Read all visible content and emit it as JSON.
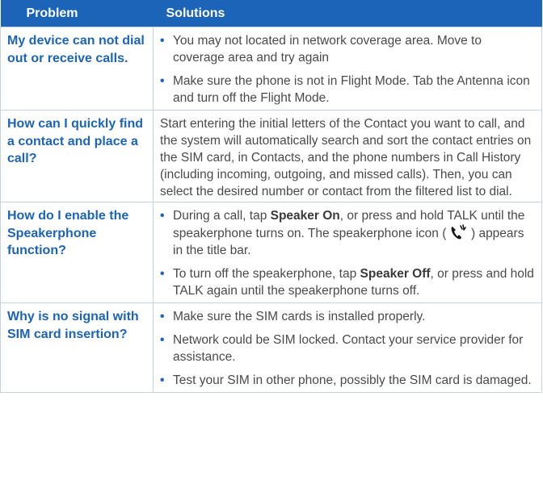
{
  "header": {
    "problem": "Problem",
    "solutions": "Solutions"
  },
  "rows": [
    {
      "problem": "My device can not dial out or receive calls.",
      "bullets": [
        "You may not located in network coverage area. Move to coverage area and try again",
        "Make sure the phone is not in Flight Mode. Tab the Antenna icon and turn off the Flight Mode."
      ]
    },
    {
      "problem": "How can I quickly find a contact and place a call?",
      "paragraph": "Start entering the initial letters of the Contact you want to call, and the system will automatically search and sort the contact entries on the SIM card, in Contacts, and the phone numbers in Call History (including incoming, outgoing, and missed calls). Then, you can select the desired number or contact from the filtered list to dial."
    },
    {
      "problem": "How do I enable the Speakerphone function?",
      "b1": {
        "pre": "During a call, tap ",
        "bold": "Speaker On",
        "post": ", or press and hold TALK until the speakerphone turns on. The speakerphone icon ( ",
        "icon": "speakerphone-icon",
        "post2": " ) appears in the title bar."
      },
      "b2": {
        "pre": "To turn off the speakerphone, tap ",
        "bold": "Speaker Off",
        "post": ", or press and hold TALK again until the speakerphone turns off."
      }
    },
    {
      "problem": "Why is no signal with SIM card insertion?",
      "bullets": [
        "Make sure the SIM cards is installed properly.",
        "Network could be SIM locked. Contact your service provider for assistance.",
        "Test your SIM in other phone, possibly the SIM card is damaged."
      ]
    }
  ],
  "bullet_char": "•",
  "colors": {
    "accent": "#1b64b8",
    "text": "#4a4a4a",
    "border": "#c8d3e0"
  }
}
